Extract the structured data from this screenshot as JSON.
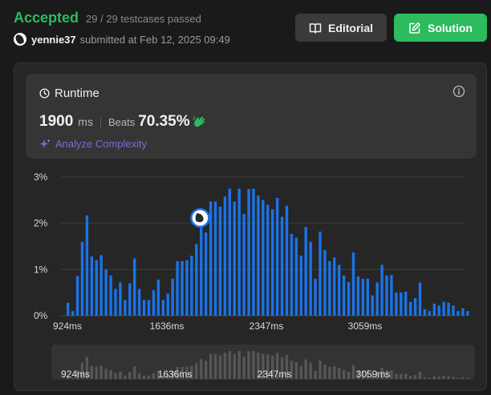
{
  "header": {
    "status": "Accepted",
    "testcases": "29 / 29 testcases passed",
    "username": "yennie37",
    "submitted_at": "submitted at Feb 12, 2025 09:49"
  },
  "actions": {
    "editorial_label": "Editorial",
    "solution_label": "Solution"
  },
  "runtime": {
    "title": "Runtime",
    "value": "1900",
    "unit": "ms",
    "beats_label": "Beats",
    "beats_percent": "70.35%",
    "analyze_label": "Analyze Complexity"
  },
  "colors": {
    "accent_green": "#2cbb5d",
    "bar_blue": "#1a73e8",
    "analyze_purple": "#7d6bd6"
  },
  "chart_data": {
    "type": "bar",
    "title": "",
    "xlabel": "",
    "ylabel": "",
    "y_ticks": [
      "3%",
      "2%",
      "1%",
      "0%"
    ],
    "ylim": [
      0,
      3
    ],
    "x_ticks": [
      "924ms",
      "1636ms",
      "2347ms",
      "3059ms"
    ],
    "grid": true,
    "values": [
      0.28,
      0.1,
      0.86,
      1.6,
      2.17,
      1.28,
      1.2,
      1.31,
      1.0,
      0.87,
      0.58,
      0.72,
      0.34,
      0.7,
      1.24,
      0.58,
      0.34,
      0.34,
      0.55,
      0.78,
      0.34,
      0.48,
      0.8,
      1.18,
      1.18,
      1.2,
      1.3,
      1.55,
      1.95,
      1.8,
      2.47,
      2.47,
      2.36,
      2.58,
      2.75,
      2.47,
      2.75,
      2.2,
      2.74,
      2.75,
      2.6,
      2.5,
      2.4,
      2.3,
      2.55,
      2.14,
      2.38,
      1.77,
      1.69,
      1.3,
      1.92,
      1.6,
      0.8,
      1.82,
      1.42,
      1.18,
      1.26,
      1.1,
      0.87,
      0.73,
      1.37,
      0.85,
      0.8,
      0.8,
      0.44,
      0.72,
      1.1,
      0.87,
      0.88,
      0.5,
      0.5,
      0.52,
      0.3,
      0.38,
      0.72,
      0.14,
      0.1,
      0.26,
      0.22,
      0.3,
      0.28,
      0.22,
      0.1,
      0.16,
      0.1
    ],
    "highlight_index": 33,
    "highlight_value": "1900 ms"
  }
}
